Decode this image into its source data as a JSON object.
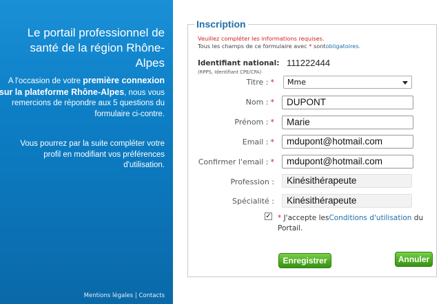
{
  "left_panel": {
    "title": "Le portail professionnel de santé de la région Rhône-Alpes",
    "intro_1": "A l'occasion de votre ",
    "intro_bold": "première connexion sur la plateforme Rhône-Alpes",
    "intro_2": ", nous vous remercions de répondre aux 5 questions du formulaire ci-contre.",
    "more": "Vous pourrez par la suite compléter votre profil en modifiant vos préférences d'utilisation.",
    "footer_legal": "Mentions légales",
    "footer_sep": " | ",
    "footer_contacts": "Contacts"
  },
  "form": {
    "legend": "Inscription",
    "notice_required": "Veuillez compléter les informations requises.",
    "notice_fields_1": "Tous les champs de ce formulaire avec ",
    "notice_star": "*",
    "notice_fields_2": " sont",
    "notice_oblig": "obligatoires.",
    "identifiant_label": "Identifiant national:",
    "identifiant_sub": "(RPPS, Identifiant CPE/CPA)",
    "identifiant_value": "111222444",
    "fields": {
      "titre": {
        "label": "Titre :",
        "value": "Mme"
      },
      "nom": {
        "label": "Nom :",
        "value": "DUPONT"
      },
      "prenom": {
        "label": "Prénom :",
        "value": "Marie"
      },
      "email": {
        "label": "Email :",
        "value": "mdupont@hotmail.com"
      },
      "confirm_email": {
        "label": "Confirmer l'email :",
        "value": "mdupont@hotmail.com"
      },
      "profession": {
        "label": "Profession :",
        "value": "Kinésithérapeute"
      },
      "specialite": {
        "label": "Spécialité :",
        "value": "Kinésithérapeute"
      }
    },
    "required_star": "*",
    "accept_star": "*",
    "accept_text_1": " J'accepte les",
    "accept_link": "Conditions d'utilisation",
    "accept_text_2": " du Portail.",
    "accept_checked": true,
    "save_label": "Enregistrer",
    "cancel_label": "Annuler"
  },
  "colors": {
    "panel_blue": "#0c73b7",
    "legend_blue": "#1f6fa8",
    "required_red": "#d2201f",
    "button_green": "#4faa22"
  }
}
